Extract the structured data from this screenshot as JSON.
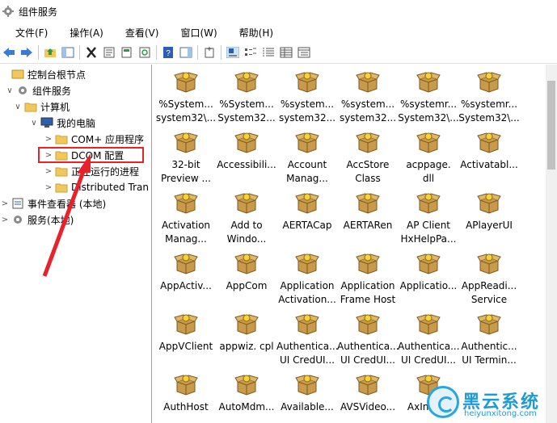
{
  "window": {
    "title": "组件服务"
  },
  "menu": [
    "文件(F)",
    "操作(A)",
    "查看(V)",
    "窗口(W)",
    "帮助(H)"
  ],
  "tree": [
    {
      "label": "控制台根节点",
      "chev": "",
      "icon": "console"
    },
    {
      "label": "组件服务",
      "chev": "∨",
      "icon": "gear"
    },
    {
      "label": "计算机",
      "chev": "∨",
      "icon": "folder"
    },
    {
      "label": "我的电脑",
      "chev": "∨",
      "icon": "computer"
    },
    {
      "label": "COM+ 应用程序",
      "chev": ">",
      "icon": "folder"
    },
    {
      "label": "DCOM 配置",
      "chev": ">",
      "icon": "folder"
    },
    {
      "label": "正在运行的进程",
      "chev": ">",
      "icon": "folder"
    },
    {
      "label": "Distributed Tran",
      "chev": ">",
      "icon": "folder"
    },
    {
      "label": "事件查看器 (本地)",
      "chev": ">",
      "icon": "viewer"
    },
    {
      "label": "服务(本地)",
      "chev": ">",
      "icon": "gear"
    }
  ],
  "items": [
    "%System...\nsystem32\\...",
    "%System...\nSystem32...",
    "%system...\nsystem32...",
    "%system...\nsystem32...",
    "%systemr...\nSystem32\\...",
    "%systemr...\nSystem32\\...",
    "32-bit\nPreview ...",
    "Accessibili...",
    "Account\nManag...",
    "AccStore\nClass",
    "acppage.\ndll",
    "Activatabl...",
    "Activation\nManag...",
    "Add to\nWindo...",
    "AERTACap",
    "AERTARen",
    "AP Client\nHxHelpPa...",
    "APlayerUI",
    "AppActiv...",
    "AppCom",
    "Application\nActivation...",
    "Application\nFrame Host",
    "Applicatio...",
    "AppReadi...\nService",
    "AppVClient",
    "appwiz. cpl",
    "Authentica...\nUI CredUI...",
    "Authentica...\nUI CredUI...",
    "Authentica...\nUI CredUI...",
    "Authentic...\nUI Termin...",
    "AuthHost",
    "AutoMdm...",
    "Available...",
    "AVSVideo...",
    "AxInstSv",
    ""
  ],
  "watermark": {
    "brand": "黑云系统",
    "url": "heiyunxitong.com"
  },
  "colors": {
    "highlight": "#e8222a",
    "folder": "#f2c75c",
    "package": "#c99a4a",
    "brand": "#1e9bd7"
  }
}
